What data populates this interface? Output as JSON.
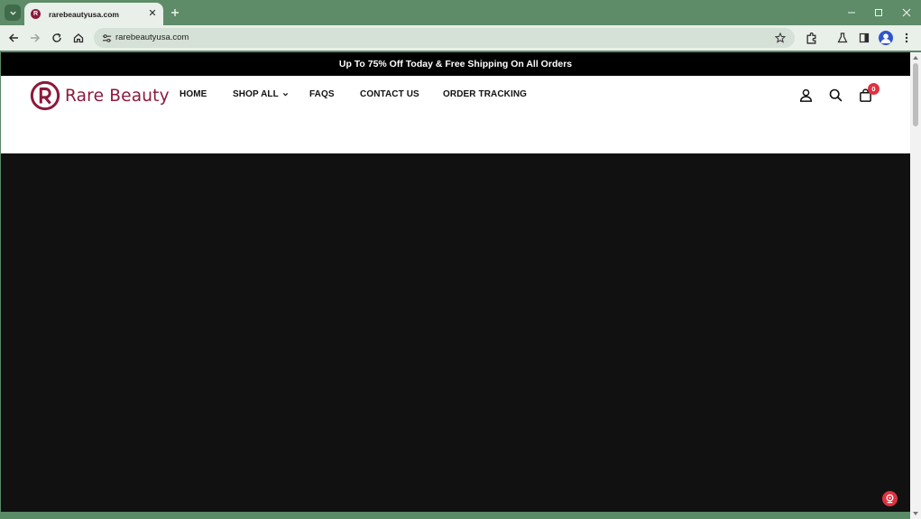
{
  "browser": {
    "tab_title": "rarebeautyusa.com",
    "tab_favicon_letter": "R",
    "url": "rarebeautyusa.com",
    "icons": [
      "tab-search-icon",
      "close-icon",
      "plus-icon",
      "minimize-icon",
      "maximize-icon",
      "close-window-icon",
      "back-arrow-icon",
      "forward-arrow-icon",
      "reload-icon",
      "home-icon",
      "site-info-icon",
      "star-icon",
      "extensions-icon",
      "labs-icon",
      "side-panel-icon",
      "profile-avatar-icon",
      "kebab-menu-icon"
    ]
  },
  "site": {
    "announcement": "Up To 75% Off Today & Free Shipping On All Orders",
    "brand": "Rare Beauty",
    "brand_color": "#8b1a3c",
    "nav": {
      "home": "HOME",
      "shop_all": "SHOP ALL",
      "faqs": "FAQS",
      "contact": "CONTACT US",
      "tracking": "ORDER TRACKING"
    },
    "cart_count": "0",
    "badge_color": "#e0313f",
    "hero_color": "#111111"
  }
}
